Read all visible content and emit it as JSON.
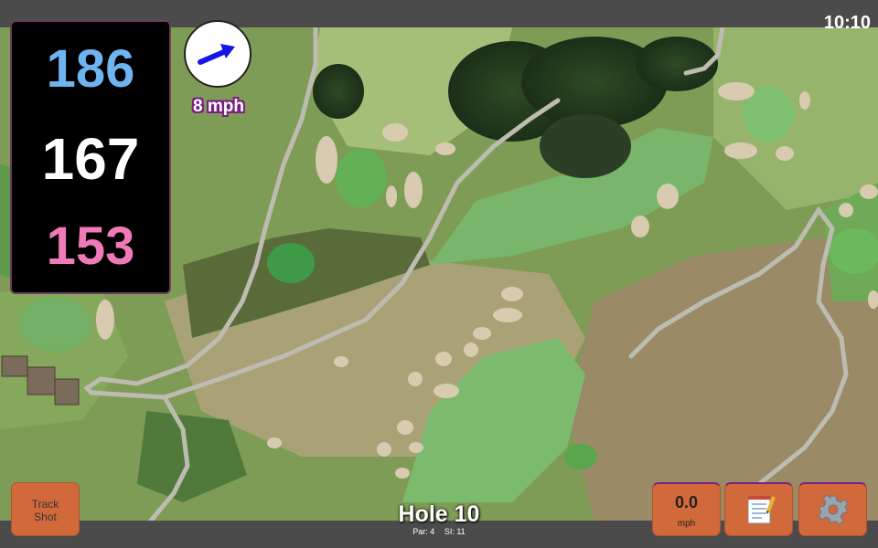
{
  "status": {
    "time": "10:10"
  },
  "distances": {
    "back": "186",
    "middle": "167",
    "front": "153"
  },
  "wind": {
    "speed_label": "8 mph",
    "direction_icon": "wind-arrow-icon"
  },
  "buttons": {
    "track_shot_line1": "Track",
    "track_shot_line2": "Shot",
    "speed_value": "0.0",
    "speed_unit": "mph",
    "notes_icon": "notepad-icon",
    "settings_icon": "gear-icon"
  },
  "hole": {
    "title": "Hole 10",
    "par": "Par: 4",
    "si": "SI: 11"
  },
  "colors": {
    "back": "#6fb3f0",
    "middle": "#ffffff",
    "front": "#f07ab8",
    "button": "#d2693b",
    "wind_arrow": "#1515e6"
  }
}
